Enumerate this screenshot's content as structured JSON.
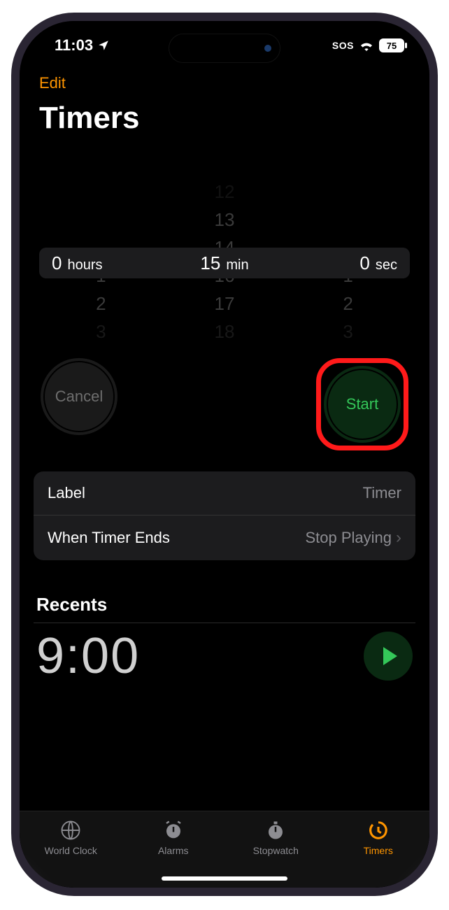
{
  "status": {
    "time": "11:03",
    "sos": "SOS",
    "battery": "75"
  },
  "nav": {
    "edit": "Edit",
    "title": "Timers"
  },
  "picker": {
    "hours_value": "0",
    "hours_unit": "hours",
    "min_value": "15",
    "min_unit": "min",
    "sec_value": "0",
    "sec_unit": "sec",
    "hours_below": [
      "1",
      "2",
      "3"
    ],
    "min_above": [
      "12",
      "13",
      "14"
    ],
    "min_below": [
      "16",
      "17",
      "18"
    ],
    "sec_below": [
      "1",
      "2",
      "3"
    ]
  },
  "buttons": {
    "cancel": "Cancel",
    "start": "Start"
  },
  "options": {
    "label_key": "Label",
    "label_val": "Timer",
    "ends_key": "When Timer Ends",
    "ends_val": "Stop Playing"
  },
  "recents": {
    "title": "Recents",
    "time": "9:00"
  },
  "tabs": {
    "world": "World Clock",
    "alarms": "Alarms",
    "stopwatch": "Stopwatch",
    "timers": "Timers"
  }
}
